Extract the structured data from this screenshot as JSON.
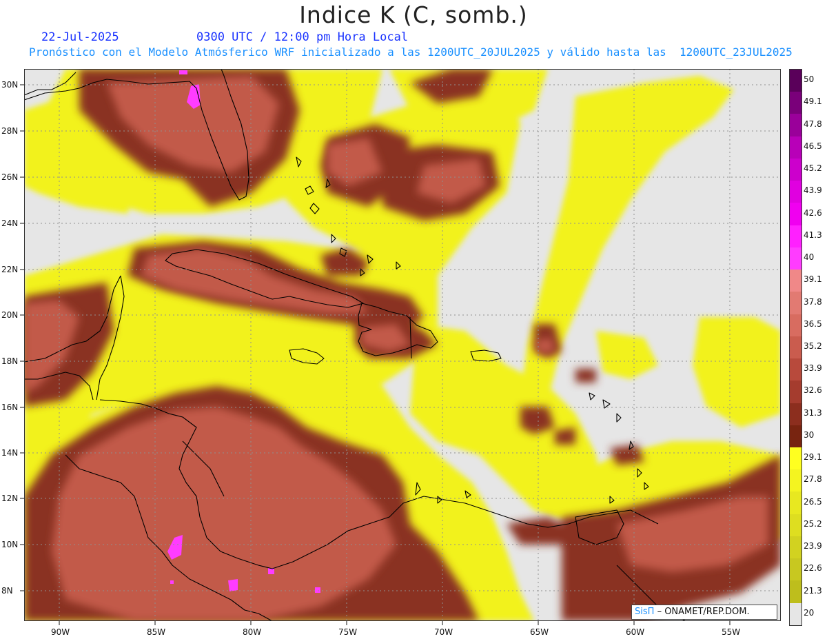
{
  "header": {
    "title": "Indice K (C, somb.)",
    "date": "22-Jul-2025",
    "time": "0300 UTC / 12:00 pm Hora Local",
    "forecast_info": "Pronóstico con el Modelo Atmósferico WRF inicializado a las 1200UTC_20JUL2025 y válido hasta las  1200UTC_23JUL2025"
  },
  "map": {
    "lat_labels": [
      "30N",
      "28N",
      "26N",
      "24N",
      "22N",
      "20N",
      "18N",
      "16N",
      "14N",
      "12N",
      "10N",
      "8N"
    ],
    "lon_labels": [
      "90W",
      "85W",
      "80W",
      "75W",
      "70W",
      "65W",
      "60W",
      "55W"
    ]
  },
  "legend": {
    "labels": [
      "50",
      "49.1",
      "47.8",
      "46.5",
      "45.2",
      "43.9",
      "42.6",
      "41.3",
      "40",
      "39.1",
      "37.8",
      "36.5",
      "35.2",
      "33.9",
      "32.6",
      "31.3",
      "30",
      "29.1",
      "27.8",
      "26.5",
      "25.2",
      "23.9",
      "22.6",
      "21.3",
      "20"
    ],
    "colors": [
      "#5a005a",
      "#7a007a",
      "#9a009a",
      "#b800b8",
      "#cc00cc",
      "#e000e0",
      "#f000f0",
      "#ff20ff",
      "#ff3cff",
      "#f08888",
      "#e27a72",
      "#d86c60",
      "#ca5c4e",
      "#b84a3c",
      "#a53c2e",
      "#8c2e1e",
      "#782410",
      "#ffff20",
      "#f4f420",
      "#e8e820",
      "#dede20",
      "#d2d220",
      "#c8c820",
      "#bebe1c",
      "#e6e6e6"
    ]
  },
  "credit": {
    "logo": "SisΠ",
    "text": "– ONAMET/REP.DOM."
  },
  "colors": {
    "no_data": "#e6e6e6",
    "yellow": "#f2f21e",
    "brown": "#8a3020",
    "red": "#c25a4a",
    "magenta": "#ff3cff"
  }
}
